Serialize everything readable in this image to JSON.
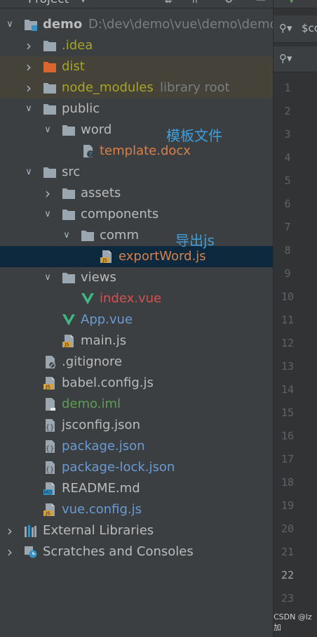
{
  "panel": {
    "title": "Project"
  },
  "tree": [
    {
      "id": "demo",
      "label": "demo",
      "sub": "D:\\dev\\demo\\vue\\demo\\demo",
      "icon": "module-folder-icon",
      "color": "#bbbbbb",
      "expand": "open",
      "bold": true
    },
    {
      "id": "idea",
      "label": ".idea",
      "icon": "folder-icon",
      "color": "#a8a526",
      "expand": "closed"
    },
    {
      "id": "dist",
      "label": "dist",
      "icon": "excluded-folder-icon",
      "color": "#a8a526",
      "expand": "closed"
    },
    {
      "id": "node_modules",
      "label": "node_modules",
      "sub": "library root",
      "icon": "folder-icon",
      "color": "#a8a526",
      "expand": "closed"
    },
    {
      "id": "public",
      "label": "public",
      "icon": "folder-icon",
      "color": "#bbbbbb",
      "expand": "open"
    },
    {
      "id": "word",
      "label": "word",
      "icon": "folder-icon",
      "color": "#bbbbbb",
      "expand": "open"
    },
    {
      "id": "template",
      "label": "template.docx",
      "icon": "unknown-file-icon",
      "color": "#d9804a",
      "expand": "none"
    },
    {
      "id": "src",
      "label": "src",
      "icon": "folder-icon",
      "color": "#bbbbbb",
      "expand": "open"
    },
    {
      "id": "assets",
      "label": "assets",
      "icon": "folder-icon",
      "color": "#bbbbbb",
      "expand": "closed"
    },
    {
      "id": "components",
      "label": "components",
      "icon": "folder-icon",
      "color": "#bbbbbb",
      "expand": "open"
    },
    {
      "id": "comm",
      "label": "comm",
      "icon": "folder-icon",
      "color": "#bbbbbb",
      "expand": "open"
    },
    {
      "id": "exportWord",
      "label": "exportWord.js",
      "icon": "js-file-icon",
      "color": "#d9804a",
      "expand": "none"
    },
    {
      "id": "views",
      "label": "views",
      "icon": "folder-icon",
      "color": "#bbbbbb",
      "expand": "open"
    },
    {
      "id": "index",
      "label": "index.vue",
      "icon": "vue-file-icon",
      "color": "#d55050",
      "expand": "none"
    },
    {
      "id": "app",
      "label": "App.vue",
      "icon": "vue-file-icon",
      "color": "#6b9bd2",
      "expand": "none"
    },
    {
      "id": "main",
      "label": "main.js",
      "icon": "js-file-icon",
      "color": "#bbbbbb",
      "expand": "none"
    },
    {
      "id": "gitignore",
      "label": ".gitignore",
      "icon": "ignore-file-icon",
      "color": "#bbbbbb",
      "expand": "none"
    },
    {
      "id": "babel",
      "label": "babel.config.js",
      "icon": "js-file-icon",
      "color": "#bbbbbb",
      "expand": "none"
    },
    {
      "id": "iml",
      "label": "demo.iml",
      "icon": "iml-file-icon",
      "color": "#5f9e55",
      "expand": "none"
    },
    {
      "id": "jsconfig",
      "label": "jsconfig.json",
      "icon": "json-file-icon",
      "color": "#bbbbbb",
      "expand": "none"
    },
    {
      "id": "package",
      "label": "package.json",
      "icon": "json-file-icon",
      "color": "#6b9bd2",
      "expand": "none"
    },
    {
      "id": "packagelock",
      "label": "package-lock.json",
      "icon": "json-file-icon",
      "color": "#6b9bd2",
      "expand": "none"
    },
    {
      "id": "readme",
      "label": "README.md",
      "icon": "markdown-file-icon",
      "color": "#bbbbbb",
      "expand": "none"
    },
    {
      "id": "vueconfig",
      "label": "vue.config.js",
      "icon": "js-file-icon",
      "color": "#6b9bd2",
      "expand": "none"
    },
    {
      "id": "extlib",
      "label": "External Libraries",
      "icon": "libraries-icon",
      "color": "#bbbbbb",
      "expand": "closed"
    },
    {
      "id": "scratches",
      "label": "Scratches and Consoles",
      "icon": "scratches-icon",
      "color": "#bbbbbb",
      "expand": "closed"
    }
  ],
  "annotations": {
    "template_note": "模板文件",
    "export_note": "导出js"
  },
  "editor": {
    "search_text": "$co",
    "line_numbers": [
      "1",
      "2",
      "3",
      "4",
      "5",
      "6",
      "7",
      "8",
      "9",
      "10",
      "11",
      "12",
      "13",
      "14",
      "15",
      "16",
      "17",
      "18",
      "19",
      "20",
      "21",
      "22",
      "23"
    ],
    "current_line": "22"
  },
  "watermark": "CSDN @lz加"
}
